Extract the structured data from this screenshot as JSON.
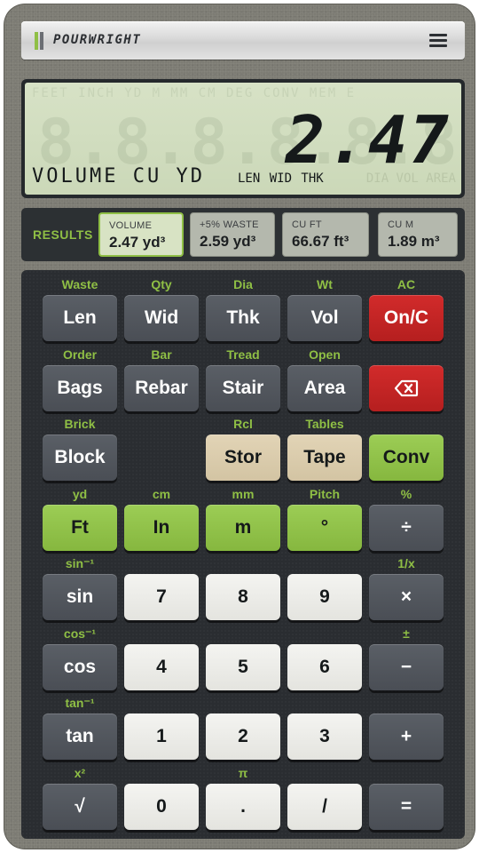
{
  "brand": {
    "name": "POURWRIGHT",
    "stripe_colors": [
      "#8fbf45",
      "#6b6e73"
    ],
    "menu_icon": "hamburger-menu-icon"
  },
  "display": {
    "ghost_indicators": "FEET INCH YD M MM CM DEG CONV MEM E",
    "ghost_digits": "8.8.8.8.8.8.8.8.",
    "value": "2.47",
    "mode": "VOLUME CU YD",
    "fields": "LEN WID THK",
    "ghost_fields": "DIA VOL AREA"
  },
  "results": {
    "label": "RESULTS",
    "cards": [
      {
        "title": "VOLUME",
        "value": "2.47 yd³",
        "active": true
      },
      {
        "title": "+5% WASTE",
        "value": "2.59 yd³",
        "active": false
      },
      {
        "title": "CU FT",
        "value": "66.67 ft³",
        "active": false
      },
      {
        "title": "CU M",
        "value": "1.89 m³",
        "active": false
      }
    ]
  },
  "keys": {
    "row1": [
      {
        "shift": "Waste",
        "label": "Len",
        "style": "dark"
      },
      {
        "shift": "Qty",
        "label": "Wid",
        "style": "dark"
      },
      {
        "shift": "Dia",
        "label": "Thk",
        "style": "dark"
      },
      {
        "shift": "Wt",
        "label": "Vol",
        "style": "dark"
      },
      {
        "shift": "AC",
        "label": "On/C",
        "style": "red"
      }
    ],
    "row2": [
      {
        "shift": "Order",
        "label": "Bags",
        "style": "dark"
      },
      {
        "shift": "Bar",
        "label": "Rebar",
        "style": "dark"
      },
      {
        "shift": "Tread",
        "label": "Stair",
        "style": "dark"
      },
      {
        "shift": "Open",
        "label": "Area",
        "style": "dark"
      },
      {
        "shift": "",
        "label": "",
        "style": "red",
        "icon": "backspace-icon"
      }
    ],
    "row3": [
      {
        "shift": "Brick",
        "label": "Block",
        "style": "dark"
      },
      {
        "shift": "Rcl",
        "label": "Stor",
        "style": "tan"
      },
      {
        "shift": "Tables",
        "label": "Tape",
        "style": "tan"
      },
      {
        "shift": "",
        "label": "Conv",
        "style": "green"
      }
    ],
    "row4": [
      {
        "shift": "yd",
        "label": "Ft",
        "style": "green"
      },
      {
        "shift": "cm",
        "label": "In",
        "style": "green"
      },
      {
        "shift": "mm",
        "label": "m",
        "style": "green"
      },
      {
        "shift": "Pitch",
        "label": "°",
        "style": "green"
      },
      {
        "shift": "%",
        "label": "÷",
        "style": "dark"
      }
    ],
    "row5": [
      {
        "shift": "sin⁻¹",
        "label": "sin",
        "style": "dark"
      },
      {
        "shift": "",
        "label": "7",
        "style": "white"
      },
      {
        "shift": "",
        "label": "8",
        "style": "white"
      },
      {
        "shift": "",
        "label": "9",
        "style": "white"
      },
      {
        "shift": "1/x",
        "label": "×",
        "style": "dark"
      }
    ],
    "row6": [
      {
        "shift": "cos⁻¹",
        "label": "cos",
        "style": "dark"
      },
      {
        "shift": "",
        "label": "4",
        "style": "white"
      },
      {
        "shift": "",
        "label": "5",
        "style": "white"
      },
      {
        "shift": "",
        "label": "6",
        "style": "white"
      },
      {
        "shift": "±",
        "label": "−",
        "style": "dark"
      }
    ],
    "row7": [
      {
        "shift": "tan⁻¹",
        "label": "tan",
        "style": "dark"
      },
      {
        "shift": "",
        "label": "1",
        "style": "white"
      },
      {
        "shift": "",
        "label": "2",
        "style": "white"
      },
      {
        "shift": "",
        "label": "3",
        "style": "white"
      },
      {
        "shift": "",
        "label": "+",
        "style": "dark"
      }
    ],
    "row8": [
      {
        "shift": "x²",
        "label": "√",
        "style": "dark"
      },
      {
        "shift": "",
        "label": "0",
        "style": "white"
      },
      {
        "shift": "π",
        "label": ".",
        "style": "white"
      },
      {
        "shift": "",
        "label": "/",
        "style": "white"
      },
      {
        "shift": "",
        "label": "=",
        "style": "dark"
      }
    ]
  }
}
